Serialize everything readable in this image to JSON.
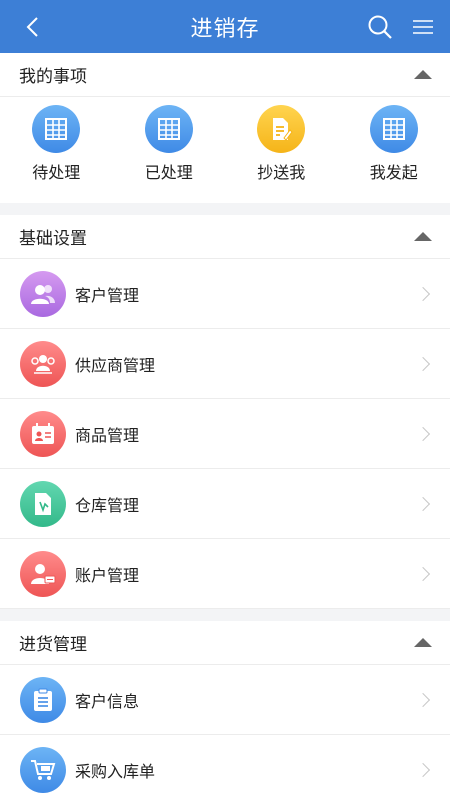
{
  "header": {
    "title": "进销存"
  },
  "my_items": {
    "title": "我的事项",
    "items": [
      {
        "label": "待处理",
        "icon": "table-icon"
      },
      {
        "label": "已处理",
        "icon": "table-icon"
      },
      {
        "label": "抄送我",
        "icon": "document-edit-icon"
      },
      {
        "label": "我发起",
        "icon": "table-icon"
      }
    ]
  },
  "basic_settings": {
    "title": "基础设置",
    "items": [
      {
        "label": "客户管理",
        "icon": "users-icon",
        "color": "#b77ae6"
      },
      {
        "label": "供应商管理",
        "icon": "supplier-icon",
        "color": "#f26a6a"
      },
      {
        "label": "商品管理",
        "icon": "product-card-icon",
        "color": "#f26a6a"
      },
      {
        "label": "仓库管理",
        "icon": "warehouse-doc-icon",
        "color": "#3fc496"
      },
      {
        "label": "账户管理",
        "icon": "account-icon",
        "color": "#f26a6a"
      }
    ]
  },
  "purchase_management": {
    "title": "进货管理",
    "items": [
      {
        "label": "客户信息",
        "icon": "clipboard-icon",
        "color": "#4a93e8"
      },
      {
        "label": "采购入库单",
        "icon": "cart-icon",
        "color": "#4a93e8"
      }
    ]
  }
}
